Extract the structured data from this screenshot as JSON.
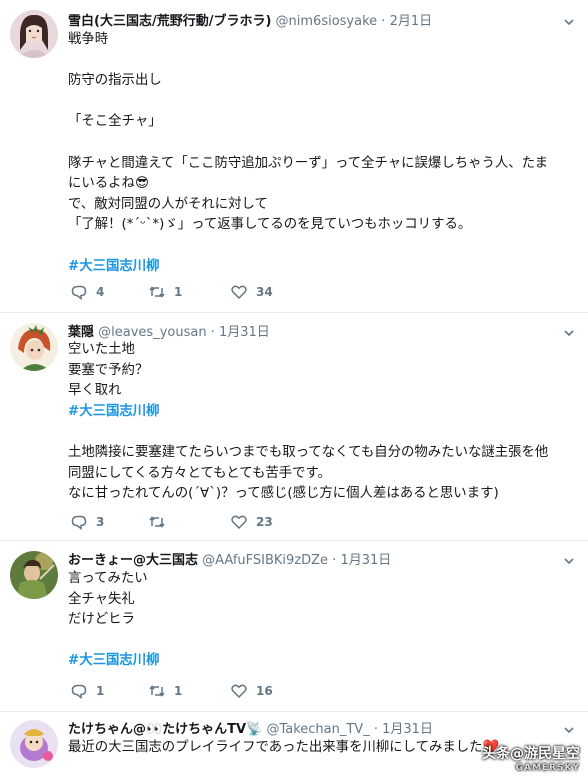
{
  "tweets": [
    {
      "display_name": "雪白(大三国志/荒野行動/ブラホラ)",
      "handle": "@nim6siosyake",
      "dot": "·",
      "date": "2月1日",
      "lines": [
        "戦争時",
        "",
        "防守の指示出し",
        "",
        "「そこ全チャ」",
        "",
        "隊チャと間違えて「ここ防守追加ぷりーず」って全チャに誤爆しちゃう人、たま",
        "にいるよね😎",
        "で、敵対同盟の人がそれに対して",
        "「了解！(*ˊᵕˋ*)ゞ」って返事してるのを見ていつもホッコリする。",
        "",
        "#大三国志川柳"
      ],
      "hashtag_line": 11,
      "reply_count": "4",
      "retweet_count": "1",
      "like_count": "34"
    },
    {
      "display_name": "葉隠",
      "handle": "@leaves_yousan",
      "dot": "·",
      "date": "1月31日",
      "lines": [
        "空いた土地",
        "要塞で予約？",
        "早く取れ",
        " #大三国志川柳",
        "",
        "土地隣接に要塞建てたらいつまでも取ってなくても自分の物みたいな謎主張を他",
        "同盟にしてくる方々とてもとても苦手です。",
        "なに甘ったれてんの(ˊ∀ˋ)？って感じ(感じ方に個人差はあると思います)"
      ],
      "hashtag_line": 3,
      "reply_count": "3",
      "retweet_count": "",
      "like_count": "23"
    },
    {
      "display_name": "おーきょー@大三国志",
      "handle": "@AAfuFSIBKi9zDZe",
      "dot": "·",
      "date": "1月31日",
      "lines": [
        "言ってみたい",
        "全チャ失礼",
        "だけどヒラ",
        "",
        "#大三国志川柳"
      ],
      "hashtag_line": 4,
      "reply_count": "1",
      "retweet_count": "1",
      "like_count": "16"
    },
    {
      "display_name": "たけちゃん@👀たけちゃんTV📡",
      "handle": "@Takechan_TV_",
      "dot": "·",
      "date": "1月31日",
      "lines": [
        "最近の大三国志のプレイライフであった出来事を川柳にしてみました❤️"
      ],
      "hashtag_line": -1,
      "reply_count": "",
      "retweet_count": "",
      "like_count": ""
    }
  ],
  "watermark": {
    "main": "头条@游民星空",
    "sub": "GAMERSKY"
  },
  "colors": {
    "text": "#14171a",
    "muted": "#657786",
    "hashtag": "#1b95e0",
    "divider": "#e6ecf0"
  },
  "icons": [
    "reply-icon",
    "retweet-icon",
    "like-icon",
    "caret-down-icon"
  ]
}
